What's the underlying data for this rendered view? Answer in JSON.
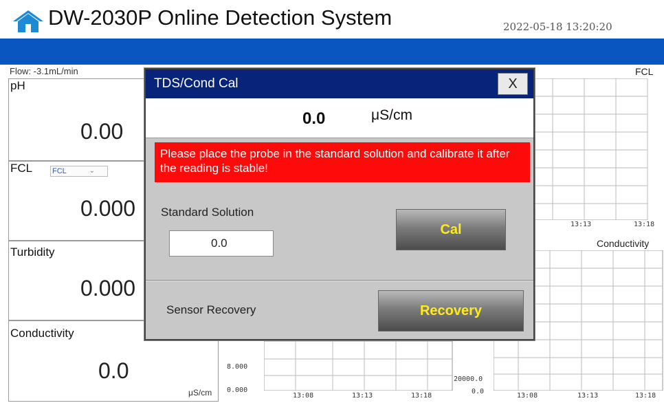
{
  "header": {
    "title": "DW-2030P Online Detection System",
    "datetime": "2022-05-18 13:20:20"
  },
  "left_panels": {
    "flow_label": "Flow: -3.1mL/min",
    "items": [
      {
        "name": "pH",
        "value": "0.00"
      },
      {
        "name": "FCL",
        "value": "0.000",
        "select_value": "FCL"
      },
      {
        "name": "Turbidity",
        "value": "0.000"
      },
      {
        "name": "Conductivity",
        "value": "0.0"
      }
    ]
  },
  "charts": {
    "fcl": {
      "title": "FCL",
      "x_ticks": [
        "13:13",
        "13:18"
      ]
    },
    "conductivity": {
      "title": "Conductivity",
      "x_ticks": [
        "13:08",
        "13:13",
        "13:18"
      ],
      "y_ticks": [
        "20000.0",
        "0.0"
      ]
    },
    "conductivity_left": {
      "unit": "μS/cm",
      "x_ticks": [
        "13:08",
        "13:13",
        "13:18"
      ],
      "y_ticks": [
        "8.000",
        "0.000"
      ]
    }
  },
  "dialog": {
    "title": "TDS/Cond Cal",
    "close_label": "X",
    "reading_value": "0.0",
    "reading_unit": "μS/cm",
    "warning": "Please place the probe in the standard solution and calibrate it after the reading is stable!",
    "standard_solution_label": "Standard Solution",
    "standard_solution_value": "0.0",
    "cal_label": "Cal",
    "sensor_recovery_label": "Sensor Recovery",
    "recovery_label": "Recovery"
  },
  "colors": {
    "header_bar": "#0a56c0",
    "dialog_titlebar": "#08237a",
    "warning_bg": "#ff0a0a",
    "button_text": "#ffeb1a"
  },
  "icons": {
    "home": "home-icon",
    "select_arrow": "chevron-down-icon"
  }
}
